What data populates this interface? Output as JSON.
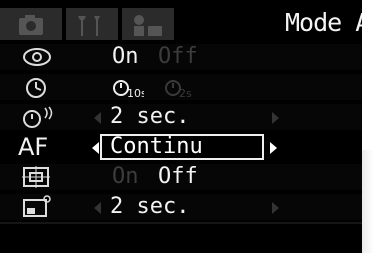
{
  "tabs": [
    {
      "name": "camera-icon",
      "active": false
    },
    {
      "name": "tools-icon",
      "active": false
    },
    {
      "name": "my-camera-icon",
      "active": false
    }
  ],
  "title": "Mode AF",
  "rows": [
    {
      "icon": "eye-icon",
      "options": [
        "On",
        "Off"
      ],
      "selected": 0
    },
    {
      "icon": "self-timer-icon",
      "options": [
        "10s",
        "2s"
      ],
      "selected": 0
    },
    {
      "icon": "remote-timer-icon",
      "value": "2 sec."
    },
    {
      "label": "AF",
      "value": "Continu"
    },
    {
      "icon": "af-frame-icon",
      "options": [
        "On",
        "Off"
      ],
      "selected": 1
    },
    {
      "icon": "review-icon",
      "value": "2 sec."
    }
  ]
}
